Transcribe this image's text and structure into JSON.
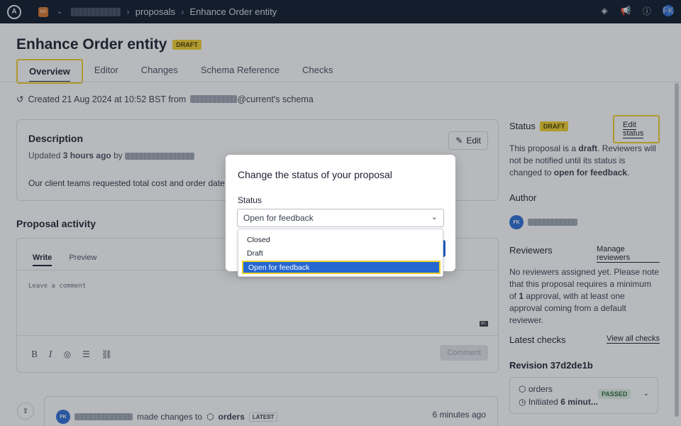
{
  "topbar": {
    "org_initials": "KG",
    "breadcrumb": [
      "proposals",
      "Enhance Order entity"
    ],
    "avatar": "FK"
  },
  "page": {
    "title": "Enhance Order entity",
    "title_badge": "DRAFT",
    "tabs": [
      "Overview",
      "Editor",
      "Changes",
      "Schema Reference",
      "Checks"
    ],
    "active_tab": "Overview",
    "created_prefix": "Created 21 Aug 2024 at 10:52 BST from",
    "created_suffix": "@current's schema"
  },
  "description": {
    "title": "Description",
    "updated_prefix": "Updated",
    "updated_time": "3 hours ago",
    "updated_by": "by",
    "edit_label": "Edit",
    "body": "Our client teams requested total cost and order date"
  },
  "activity": {
    "title": "Proposal activity",
    "tabs": [
      "Write",
      "Preview"
    ],
    "placeholder": "Leave a comment",
    "md_badge": "M↓",
    "comment_button": "Comment",
    "item": {
      "avatar": "FK",
      "action": "made changes to",
      "target": "orders",
      "badge": "LATEST",
      "time": "6 minutes ago"
    }
  },
  "sidebar": {
    "status_label": "Status",
    "status_badge": "DRAFT",
    "edit_status": "Edit status",
    "status_text_1": "This proposal is a",
    "status_text_bold1": "draft",
    "status_text_2": ". Reviewers will not be notified until its status is changed to",
    "status_text_bold2": "open for feedback",
    "status_text_3": ".",
    "author_label": "Author",
    "author_avatar": "FK",
    "reviewers_label": "Reviewers",
    "manage_reviewers": "Manage reviewers",
    "no_reviewers_1": "No reviewers assigned yet. Please note that this proposal requires a minimum of",
    "no_reviewers_bold": "1",
    "no_reviewers_2": "approval, with at least one approval coming from a default reviewer.",
    "latest_checks": "Latest checks",
    "view_all_checks": "View all checks",
    "revision": "Revision 37d2de1b",
    "check_name": "orders",
    "check_sub_prefix": "Initiated",
    "check_sub_bold": "6 minut...",
    "check_status": "PASSED"
  },
  "modal": {
    "title": "Change the status of your proposal",
    "status_label": "Status",
    "selected_value": "Open for feedback",
    "options": [
      "Closed",
      "Draft",
      "Open for feedback"
    ]
  },
  "colors": {
    "accent": "#2467d1",
    "highlight": "#f0d230",
    "draft_badge": "#f2d22e",
    "passed_badge": "#e3f2e6",
    "topbar": "#0f1a2b"
  }
}
